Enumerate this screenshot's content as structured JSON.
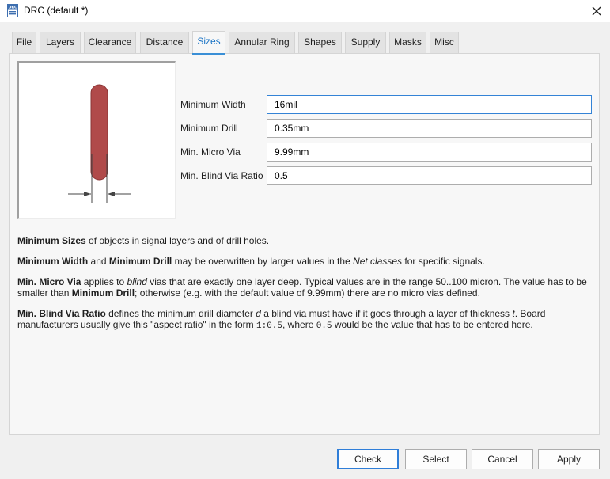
{
  "window": {
    "title": "DRC (default *)",
    "icon": "drc-app-icon",
    "close_icon": "close-icon"
  },
  "tabs": [
    {
      "label": "File"
    },
    {
      "label": "Layers"
    },
    {
      "label": "Clearance"
    },
    {
      "label": "Distance"
    },
    {
      "label": "Sizes",
      "active": true
    },
    {
      "label": "Annular Ring"
    },
    {
      "label": "Shapes"
    },
    {
      "label": "Supply"
    },
    {
      "label": "Masks"
    },
    {
      "label": "Misc"
    }
  ],
  "fields": {
    "min_width": {
      "label": "Minimum Width",
      "value": "16mil"
    },
    "min_drill": {
      "label": "Minimum Drill",
      "value": "0.35mm"
    },
    "min_micro_via": {
      "label": "Min. Micro Via",
      "value": "9.99mm"
    },
    "min_blind_via_ratio": {
      "label": "Min. Blind Via Ratio",
      "value": "0.5"
    }
  },
  "description": {
    "p1": {
      "b1": "Minimum Sizes",
      "t1": " of objects in signal layers and of drill holes."
    },
    "p2": {
      "b1": "Minimum Width",
      "t1": " and ",
      "b2": "Minimum Drill",
      "t2": " may be overwritten by larger values in the ",
      "i1": "Net classes",
      "t3": " for specific signals."
    },
    "p3": {
      "b1": "Min. Micro Via",
      "t1": " applies to ",
      "i1": "blind",
      "t2": " vias that are exactly one layer deep. Typical values are in the range 50..100 micron. The value has to be smaller than ",
      "b2": "Minimum Drill",
      "t3": "; otherwise (e.g. with the default value of 9.99mm) there are no micro vias defined."
    },
    "p4": {
      "b1": "Min. Blind Via Ratio",
      "t1": " defines the minimum drill diameter ",
      "i1": "d",
      "t2": " a blind via must have if it goes through a layer of thickness ",
      "i2": "t",
      "t3": ". Board manufacturers usually give this \"aspect ratio\" in the form ",
      "m1": "1:0.5",
      "t4": ", where ",
      "m2": "0.5",
      "t5": " would be the value that has to be entered here."
    }
  },
  "buttons": {
    "check": "Check",
    "select": "Select",
    "cancel": "Cancel",
    "apply": "Apply"
  },
  "colors": {
    "accent": "#1b74c5",
    "trace": "#b04a4a",
    "focus_border": "#3483d6"
  }
}
